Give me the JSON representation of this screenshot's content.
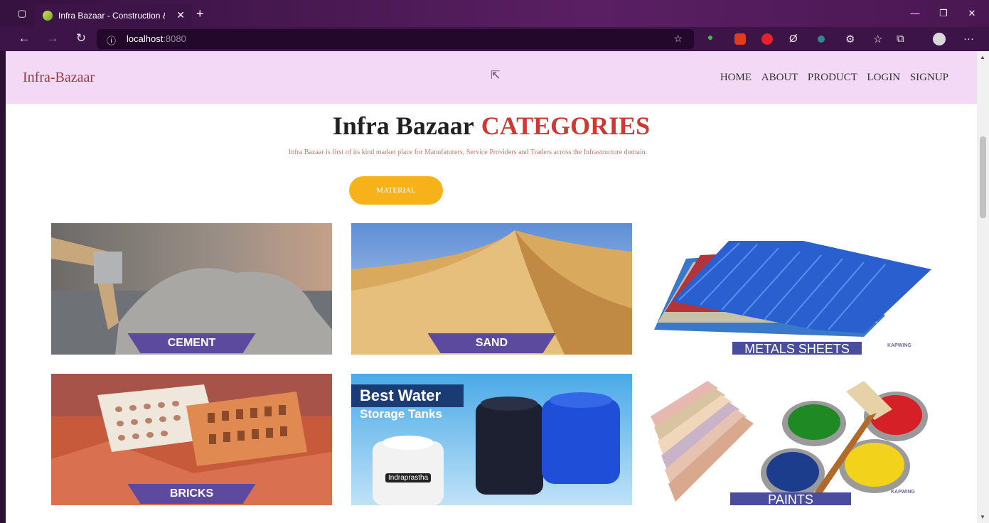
{
  "browser": {
    "tab_title": "Infra Bazaar - Construction & Bu",
    "url_host": "localhost",
    "url_port": ":8080"
  },
  "navbar": {
    "brand": "Infra-Bazaar",
    "links": [
      "HOME",
      "ABOUT",
      "PRODUCT",
      "LOGIN",
      "SIGNUP"
    ]
  },
  "hero": {
    "title_main": "Infra Bazaar",
    "title_accent": "CATEGORIES",
    "subtitle": "Infra Bazaar is first of its kind market place for Manufaturers, Service Providers and Traders across the Infrastructure domain.",
    "filter_button": "MATERIAL"
  },
  "categories": [
    {
      "label": "CEMENT"
    },
    {
      "label": "SAND"
    },
    {
      "label": "METALS SHEETS",
      "watermark": "KAPWING"
    },
    {
      "label": "BRICKS"
    },
    {
      "label": "",
      "image_text_1": "Best Water",
      "image_text_2": "Storage Tanks",
      "brand": "Indraprastha"
    },
    {
      "label": "PAINTS",
      "watermark": "KAPWING"
    }
  ],
  "colors": {
    "navbar_bg": "#f3d9f5",
    "brand": "#9b3b3b",
    "accent": "#cc3a33",
    "button": "#f7b21a",
    "label_bg": "#5b4a9e"
  }
}
